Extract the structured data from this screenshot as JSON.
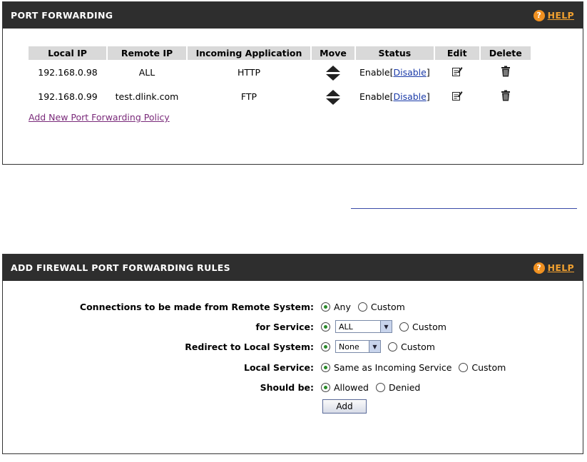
{
  "port_forwarding": {
    "title": "PORT FORWARDING",
    "help_label": "HELP",
    "columns": [
      "Local IP",
      "Remote IP",
      "Incoming Application",
      "Move",
      "Status",
      "Edit",
      "Delete"
    ],
    "rows": [
      {
        "local_ip": "192.168.0.98",
        "remote_ip": "ALL",
        "app": "HTTP",
        "status": "Enable",
        "toggle": "Disable"
      },
      {
        "local_ip": "192.168.0.99",
        "remote_ip": "test.dlink.com",
        "app": "FTP",
        "status": "Enable",
        "toggle": "Disable"
      }
    ],
    "add_link": "Add New Port Forwarding Policy"
  },
  "add_rules": {
    "title": "ADD FIREWALL PORT FORWARDING RULES",
    "help_label": "HELP",
    "remote_label": "Connections to be made from Remote System:",
    "remote_any": "Any",
    "remote_custom": "Custom",
    "service_label": "for Service:",
    "service_value": "ALL",
    "service_custom": "Custom",
    "redirect_label": "Redirect to Local System:",
    "redirect_value": "None",
    "redirect_custom": "Custom",
    "local_service_label": "Local Service:",
    "local_service_same": "Same as Incoming Service",
    "local_service_custom": "Custom",
    "should_label": "Should be:",
    "should_allowed": "Allowed",
    "should_denied": "Denied",
    "add_button": "Add"
  }
}
